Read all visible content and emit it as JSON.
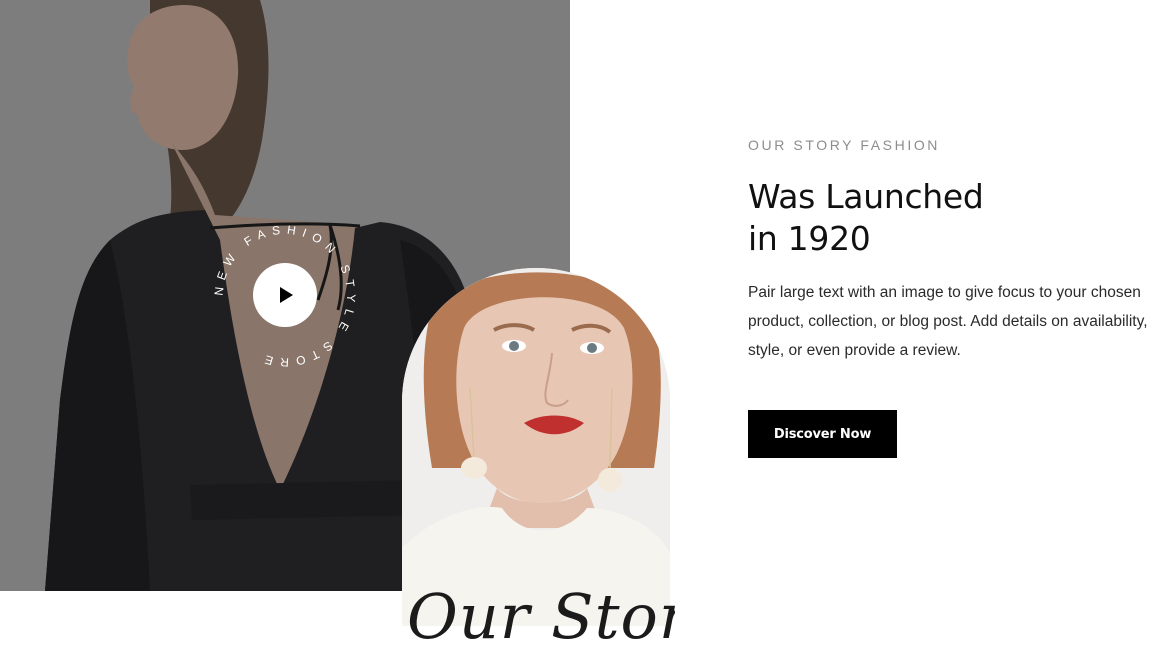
{
  "story": {
    "eyebrow": "OUR STORY FASHION",
    "headline_line1": "Was Launched",
    "headline_line2": "in 1920",
    "body": "Pair large text with an image to give focus to your chosen product, collection, or blog post. Add details on availability, style, or even provide a review.",
    "cta_label": "Discover Now"
  },
  "badge": {
    "circular_text": "NEW FASHION STYLE STORE",
    "icon": "play-icon"
  },
  "signature": {
    "text": "Our Story"
  },
  "colors": {
    "accent": "#000000",
    "eyebrow": "#8d8d8d",
    "heading": "#111111",
    "body": "#2a2a2a"
  }
}
